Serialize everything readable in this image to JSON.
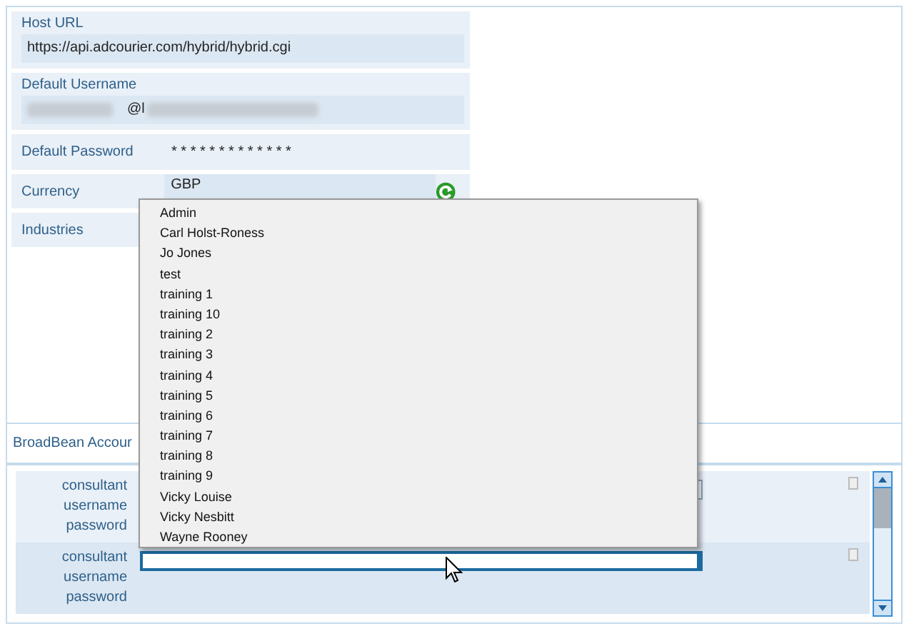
{
  "settings": [
    {
      "kind": "field",
      "label": "Host URL",
      "value": "https://api.adcourier.com/hybrid/hybrid.cgi"
    },
    {
      "kind": "redacted",
      "label": "Default Username",
      "value": "@l"
    },
    {
      "kind": "password",
      "label": "Default Password",
      "value": "* * * * * * * * * * * * *"
    },
    {
      "kind": "list",
      "label": "Currency",
      "value": "GBP"
    },
    {
      "kind": "plain",
      "label": "Industries"
    }
  ],
  "accounts_section": {
    "title": "BroadBean Accour"
  },
  "accounts": [
    {
      "labels": [
        "consultant",
        "username",
        "password"
      ],
      "focused": false
    },
    {
      "labels": [
        "consultant",
        "username",
        "password"
      ],
      "focused": true
    }
  ],
  "dropdown": {
    "options": [
      "Admin",
      "Carl Holst-Roness",
      "Jo Jones",
      "test",
      "training 1",
      "training 10",
      "training 2",
      "training 3",
      "training 4",
      "training 5",
      "training 6",
      "training 7",
      "training 8",
      "training 9",
      "Vicky Louise",
      "Vicky Nesbitt",
      "Wayne Rooney"
    ]
  }
}
